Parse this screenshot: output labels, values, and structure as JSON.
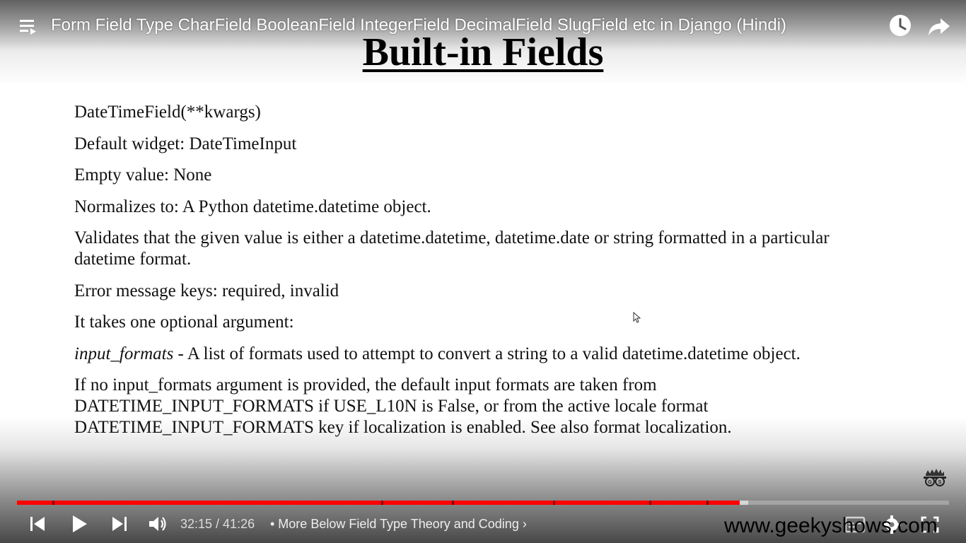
{
  "header": {
    "video_title": "Form Field Type CharField BooleanField IntegerField DecimalField SlugField etc in Django (Hindi)",
    "icons": [
      "playlist-icon",
      "watch-later-icon",
      "share-icon"
    ]
  },
  "slide": {
    "title": "Built-in Fields",
    "paragraphs": [
      "DateTimeField(**kwargs)",
      "Default widget: DateTimeInput",
      "Empty value: None",
      "Normalizes to: A Python datetime.datetime object.",
      "Validates that the given value is either a datetime.datetime, datetime.date or string formatted in a particular datetime format.",
      "Error message keys: required, invalid",
      "It takes one optional argument:",
      "- A list of formats used to attempt to convert a string to a valid datetime.datetime object.",
      "If no input_formats argument is provided, the default input formats are taken from DATETIME_INPUT_FORMATS if USE_L10N is False, or from the active locale format DATETIME_INPUT_FORMATS key if localization is enabled. See also format localization."
    ],
    "italic_term": "input_formats"
  },
  "player": {
    "time": "32:15 / 41:26",
    "chapter_label": "• More Below Field Type Theory and Coding",
    "chapter_arrow": "›",
    "progress_fraction": 0.7755,
    "buffered_fraction": 0.7845,
    "controls": [
      "previous-icon",
      "play-icon",
      "next-icon",
      "volume-icon",
      "subtitles-icon",
      "settings-icon",
      "fullscreen-icon"
    ]
  },
  "watermark": {
    "site": "www.geekyshows.com",
    "logo_text": "G S"
  },
  "colors": {
    "played": "#ff0000",
    "text": "#111111",
    "overlay_text": "#ffffff"
  }
}
